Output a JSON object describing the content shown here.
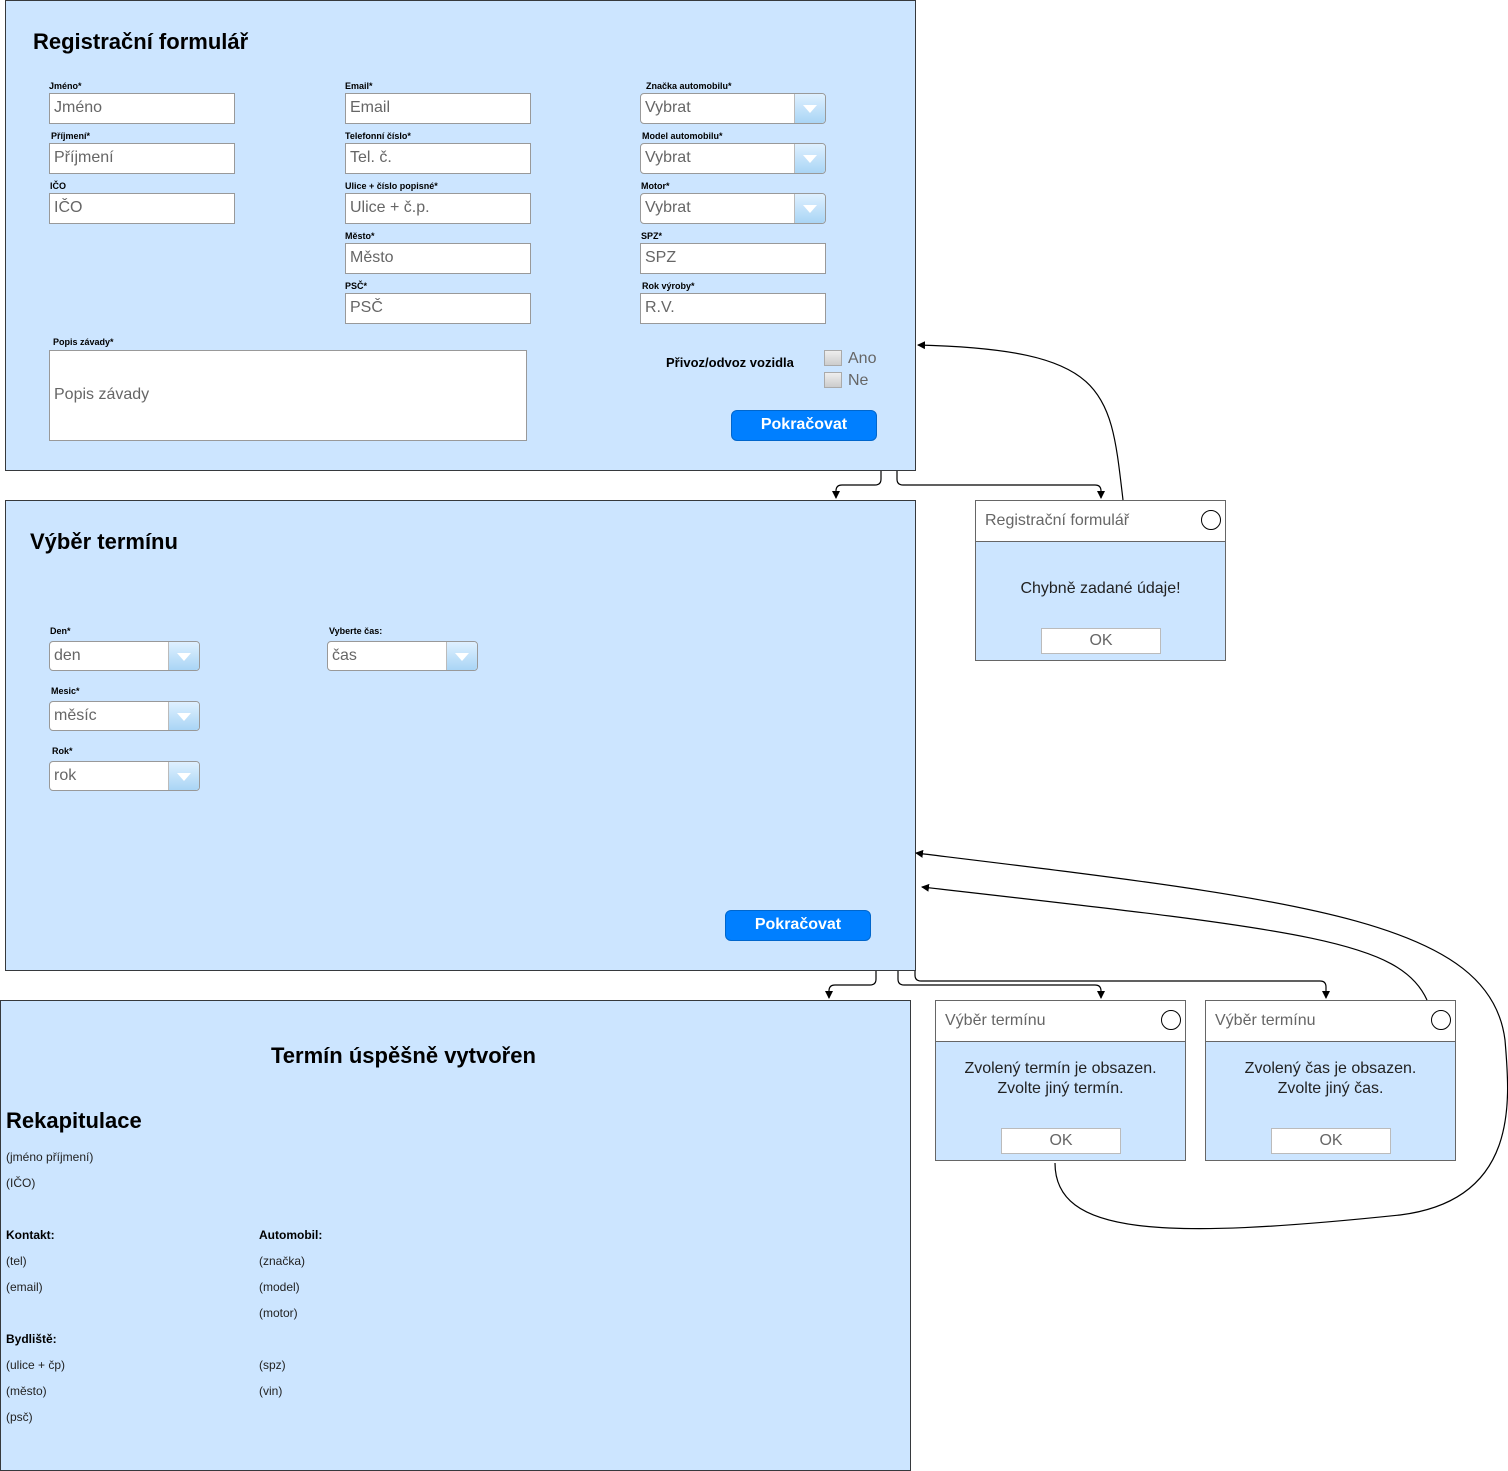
{
  "registration": {
    "title": "Registrační formulář",
    "fields": {
      "first_name": {
        "label": "Jméno*",
        "placeholder": "Jméno"
      },
      "last_name": {
        "label": "Příjmení*",
        "placeholder": "Příjmení"
      },
      "ico": {
        "label": "IČO",
        "placeholder": "IČO"
      },
      "email": {
        "label": "Email*",
        "placeholder": "Email"
      },
      "phone": {
        "label": "Telefonní číslo*",
        "placeholder": "Tel. č."
      },
      "street": {
        "label": "Ulice + číslo popisné*",
        "placeholder": "Ulice + č.p."
      },
      "city": {
        "label": "Město*",
        "placeholder": "Město"
      },
      "zip": {
        "label": "PSČ*",
        "placeholder": "PSČ"
      },
      "car_brand": {
        "label": "Značka automobilu*",
        "value": "Vybrat"
      },
      "car_model": {
        "label": "Model automobilu*",
        "value": "Vybrat"
      },
      "engine": {
        "label": "Motor*",
        "value": "Vybrat"
      },
      "spz": {
        "label": "SPZ*",
        "placeholder": "SPZ"
      },
      "year": {
        "label": "Rok výroby*",
        "placeholder": "R.V."
      },
      "fault": {
        "label": "Popis závady*",
        "placeholder": "Popis závady"
      }
    },
    "transport_label": "Přivoz/odvoz vozidla",
    "yes_label": "Ano",
    "no_label": "Ne",
    "continue_label": "Pokračovat"
  },
  "term": {
    "title": "Výběr termínu",
    "day": {
      "label": "Den*",
      "value": "den"
    },
    "month": {
      "label": "Mesic*",
      "value": "měsíc"
    },
    "year": {
      "label": "Rok*",
      "value": "rok"
    },
    "time": {
      "label": "Vyberte čas:",
      "value": "čas"
    },
    "continue_label": "Pokračovat"
  },
  "success": {
    "title": "Termín úspěšně vytvořen",
    "recap_title": "Rekapitulace",
    "name": "(jméno příjmení)",
    "ico": "(IČO)",
    "contact_label": "Kontakt:",
    "tel": "(tel)",
    "email": "(email)",
    "residence_label": "Bydliště:",
    "street": "(ulice + čp)",
    "city": "(město)",
    "zip": "(psč)",
    "car_label": "Automobil:",
    "brand": "(značka)",
    "model": "(model)",
    "engine": "(motor)",
    "spz": "(spz)",
    "vin": "(vin)"
  },
  "dialogs": {
    "reg_error": {
      "title": "Registrační formulář",
      "message": "Chybně zadané údaje!",
      "ok": "OK"
    },
    "term_taken": {
      "title": "Výběr termínu",
      "line1": "Zvolený termín je obsazen.",
      "line2": "Zvolte jiný termín.",
      "ok": "OK"
    },
    "time_taken": {
      "title": "Výběr termínu",
      "line1": "Zvolený čas je obsazen.",
      "line2": "Zvolte jiný čas.",
      "ok": "OK"
    }
  },
  "colors": {
    "panel": "#cce5ff",
    "button": "#007fff"
  }
}
